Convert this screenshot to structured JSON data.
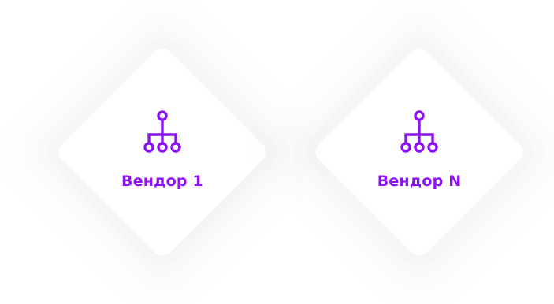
{
  "colors": {
    "accent": "#8a12f5",
    "background": "#ffffff"
  },
  "vendors": [
    {
      "label": "Вендор 1",
      "icon": "network-hierarchy-icon"
    },
    {
      "label": "Вендор N",
      "icon": "network-hierarchy-icon"
    }
  ]
}
